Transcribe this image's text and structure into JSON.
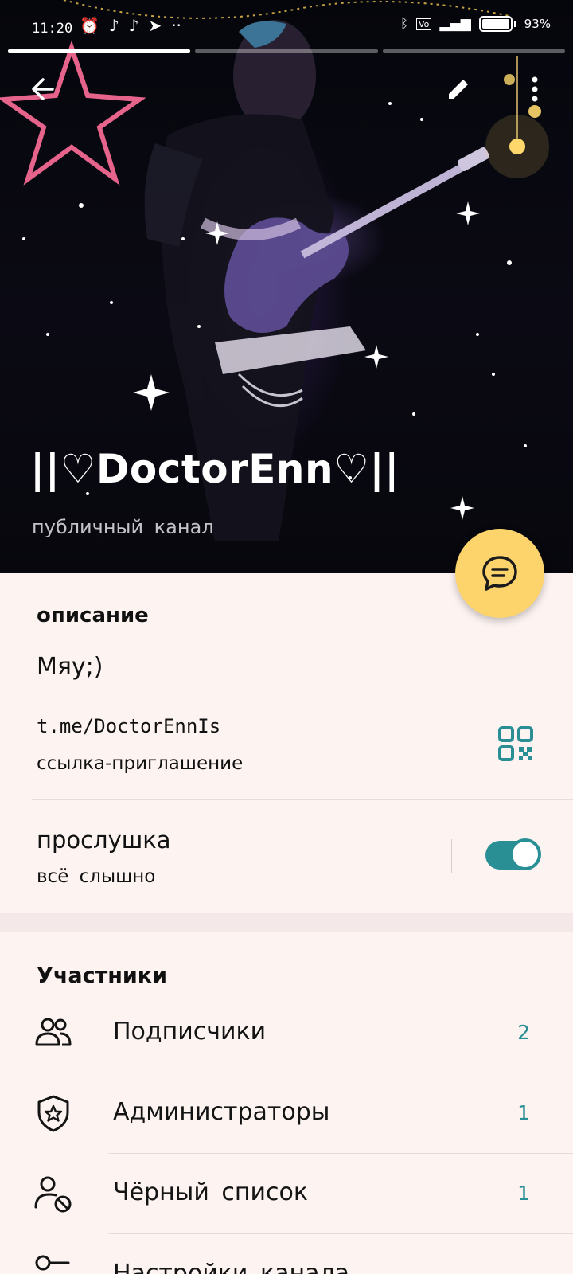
{
  "statusbar": {
    "time": "11:20",
    "battery": "93%",
    "icons_left": [
      "alarm-icon",
      "tiktok-icon",
      "tiktok-icon",
      "telegram-icon",
      "more-dots-icon"
    ],
    "icons_right": [
      "bluetooth-icon",
      "volte-icon",
      "signal-icon",
      "battery-icon"
    ]
  },
  "channel": {
    "title": "||♡DoctorEnn♡||",
    "subtitle": "публичный канал"
  },
  "info": {
    "description_label": "описание",
    "description_text": "Мяу;)",
    "link": "t.me/DoctorEnnIs",
    "link_caption": "ссылка-приглашение",
    "listening_label": "прослушка",
    "listening_sub": "всё слышно",
    "listening_enabled": true
  },
  "members": {
    "section_label": "Участники",
    "rows": [
      {
        "icon": "users-icon",
        "label": "Подписчики",
        "count": "2"
      },
      {
        "icon": "shield-star-icon",
        "label": "Администраторы",
        "count": "1"
      },
      {
        "icon": "user-blocked-icon",
        "label": "Чёрный список",
        "count": "1"
      },
      {
        "icon": "key-icon",
        "label": "Настройки канала",
        "count": ""
      }
    ]
  },
  "colors": {
    "accent": "#2a8f95",
    "fab": "#fdd46b",
    "background": "#fdf4f2"
  }
}
